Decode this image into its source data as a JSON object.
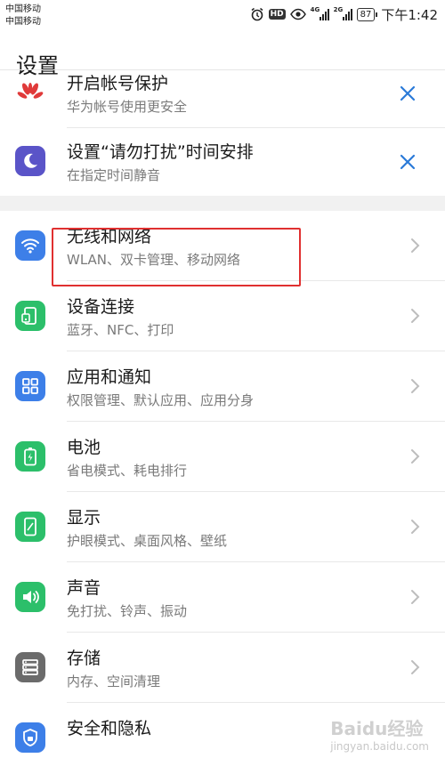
{
  "status": {
    "carrier1": "中国移动",
    "carrier2": "中国移动",
    "net1": "4G",
    "net2": "2G",
    "battery": "87",
    "time": "下午1:42",
    "hd": "HD"
  },
  "page": {
    "title": "设置"
  },
  "notices": [
    {
      "title": "开启帐号保护",
      "subtitle": "华为帐号使用更安全",
      "icon": "huawei-logo-icon",
      "color": "#e03a3a"
    },
    {
      "title": "设置“请勿打扰”时间安排",
      "subtitle": "在指定时间静音",
      "icon": "moon-icon",
      "color": "#5a54c8"
    }
  ],
  "items": [
    {
      "title": "无线和网络",
      "subtitle": "WLAN、双卡管理、移动网络",
      "icon": "wifi-icon",
      "color": "#3d7fe8"
    },
    {
      "title": "设备连接",
      "subtitle": "蓝牙、NFC、打印",
      "icon": "device-connection-icon",
      "color": "#2cbf6a"
    },
    {
      "title": "应用和通知",
      "subtitle": "权限管理、默认应用、应用分身",
      "icon": "apps-grid-icon",
      "color": "#3d7fe8"
    },
    {
      "title": "电池",
      "subtitle": "省电模式、耗电排行",
      "icon": "battery-icon",
      "color": "#2cbf6a"
    },
    {
      "title": "显示",
      "subtitle": "护眼模式、桌面风格、壁纸",
      "icon": "display-icon",
      "color": "#2cbf6a"
    },
    {
      "title": "声音",
      "subtitle": "免打扰、铃声、振动",
      "icon": "speaker-icon",
      "color": "#2cbf6a"
    },
    {
      "title": "存储",
      "subtitle": "内存、空间清理",
      "icon": "storage-icon",
      "color": "#6b6b6b"
    },
    {
      "title": "安全和隐私",
      "subtitle": "",
      "icon": "shield-icon",
      "color": "#3d7fe8"
    }
  ],
  "watermark": {
    "brand": "Baidu经验",
    "url": "jingyan.baidu.com"
  }
}
